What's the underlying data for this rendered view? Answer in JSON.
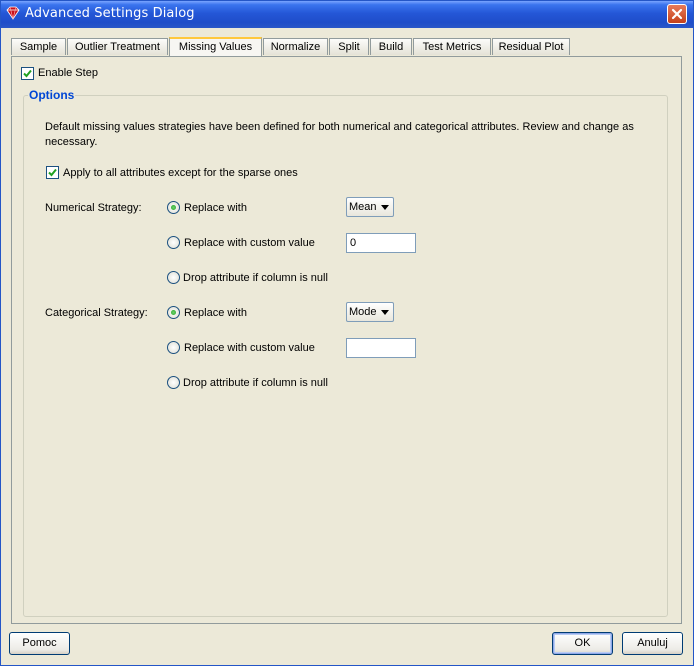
{
  "window": {
    "title": "Advanced Settings Dialog",
    "icon": "red-diamond-app-icon"
  },
  "tabs": [
    {
      "label": "Sample",
      "active": false
    },
    {
      "label": "Outlier Treatment",
      "active": false
    },
    {
      "label": "Missing Values",
      "active": true
    },
    {
      "label": "Normalize",
      "active": false
    },
    {
      "label": "Split",
      "active": false
    },
    {
      "label": "Build",
      "active": false
    },
    {
      "label": "Test Metrics",
      "active": false
    },
    {
      "label": "Residual Plot",
      "active": false
    }
  ],
  "enable_step": {
    "label": "Enable Step",
    "checked": true
  },
  "options": {
    "title": "Options",
    "description": "Default missing values strategies have been defined for both numerical and categorical attributes.  Review and change as necessary.",
    "apply_all": {
      "label": "Apply to all attributes except for the sparse ones",
      "checked": true
    },
    "numerical": {
      "label": "Numerical Strategy:",
      "replace_with": {
        "label": "Replace with",
        "selected": true
      },
      "combo_value": "Mean",
      "custom": {
        "label": "Replace with custom value",
        "selected": false
      },
      "custom_value": "0",
      "drop": {
        "label": "Drop attribute if column is null",
        "selected": false
      }
    },
    "categorical": {
      "label": "Categorical Strategy:",
      "replace_with": {
        "label": "Replace with",
        "selected": true
      },
      "combo_value": "Mode",
      "custom": {
        "label": "Replace with custom value",
        "selected": false
      },
      "custom_value": "",
      "drop": {
        "label": "Drop attribute if column is null",
        "selected": false
      }
    }
  },
  "buttons": {
    "help": "Pomoc",
    "ok": "OK",
    "cancel": "Anuluj"
  },
  "colors": {
    "titlebar": "#2457d7",
    "dialog_bg": "#ece9d8",
    "group_title": "#0046d5",
    "active_tab_accent": "#ffc83c",
    "radio_dot": "#21a121",
    "close_button": "#c4401a"
  }
}
